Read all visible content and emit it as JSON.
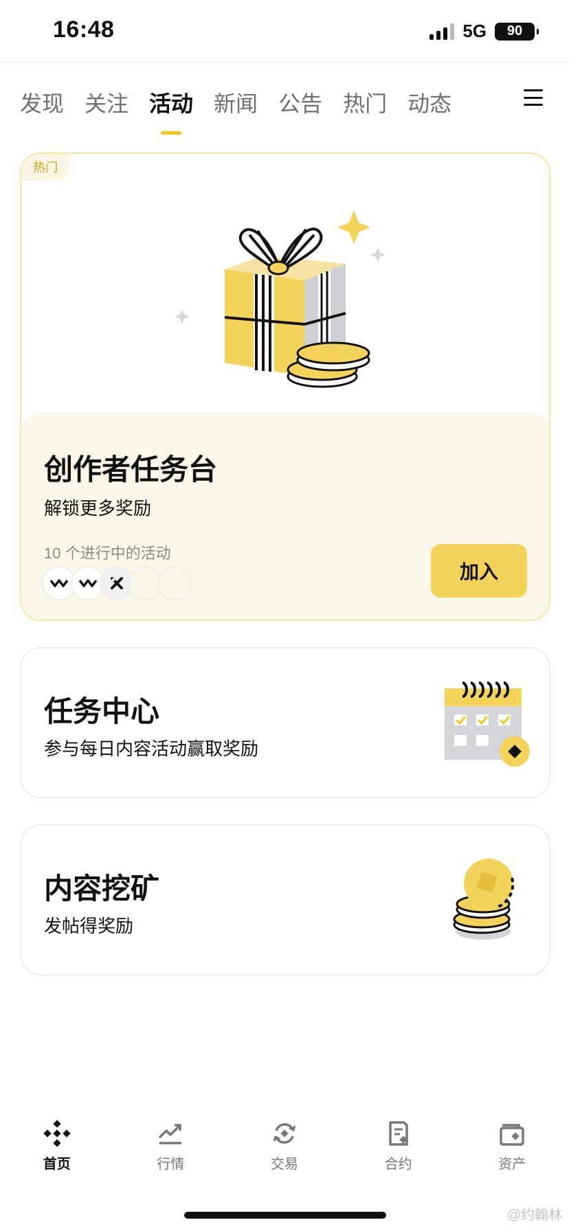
{
  "status_bar": {
    "time": "16:48",
    "network": "5G",
    "battery": "90"
  },
  "tabs": [
    {
      "label": "发现",
      "active": false
    },
    {
      "label": "关注",
      "active": false
    },
    {
      "label": "活动",
      "active": true
    },
    {
      "label": "新闻",
      "active": false
    },
    {
      "label": "公告",
      "active": false
    },
    {
      "label": "热门",
      "active": false
    },
    {
      "label": "动态",
      "active": false
    }
  ],
  "feature_card": {
    "tag": "热门",
    "title": "创作者任务台",
    "subtitle": "解锁更多奖励",
    "count_text": "10 个进行中的活动",
    "badges": [
      "wave-badge-icon",
      "wave-badge-icon",
      "x-badge-icon",
      "empty",
      "empty"
    ],
    "join_label": "加入"
  },
  "cards": [
    {
      "title": "任务中心",
      "subtitle": "参与每日内容活动赢取奖励",
      "icon": "calendar-icon"
    },
    {
      "title": "内容挖矿",
      "subtitle": "发帖得奖励",
      "icon": "coin-stack-icon"
    }
  ],
  "bottom_nav": [
    {
      "label": "首页",
      "icon": "home-logo-icon",
      "active": true
    },
    {
      "label": "行情",
      "icon": "chart-icon",
      "active": false
    },
    {
      "label": "交易",
      "icon": "trade-icon",
      "active": false
    },
    {
      "label": "合约",
      "icon": "contract-icon",
      "active": false
    },
    {
      "label": "资产",
      "icon": "wallet-icon",
      "active": false
    }
  ],
  "watermark": "@约翰林",
  "colors": {
    "accent": "#F3C51B",
    "button": "#F4D35A",
    "card_bg": "#FBF7E9",
    "card_border": "#F6E5A3"
  }
}
